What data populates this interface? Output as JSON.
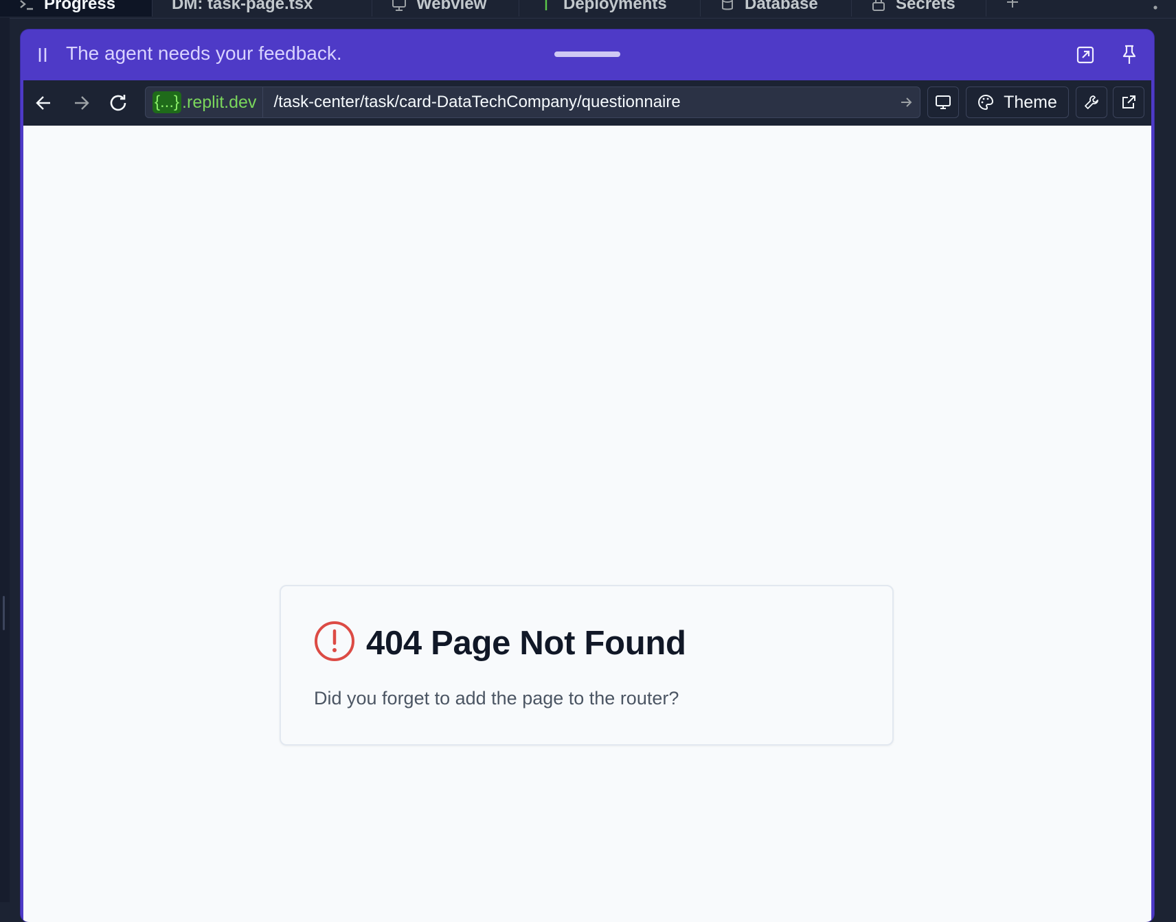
{
  "tabs": [
    {
      "label": "Progress",
      "icon": "progress-icon"
    },
    {
      "label": "DM: task-page.tsx",
      "icon": "file-icon"
    },
    {
      "label": "Webview",
      "icon": "webview-icon"
    },
    {
      "label": "Deployments",
      "icon": "deploy-icon"
    },
    {
      "label": "Database",
      "icon": "database-icon"
    },
    {
      "label": "Secrets",
      "icon": "lock-icon"
    }
  ],
  "agent_bar": {
    "message": "The agent needs your feedback.",
    "bg_color": "#4e3ac7"
  },
  "browser": {
    "domain_token": "{...}",
    "domain_suffix": ".replit.dev",
    "path": "/task-center/task/card-DataTechCompany/questionnaire",
    "theme_label": "Theme"
  },
  "page": {
    "title": "404 Page Not Found",
    "message": "Did you forget to add the page to the router?",
    "error_color": "#dc4b45"
  }
}
